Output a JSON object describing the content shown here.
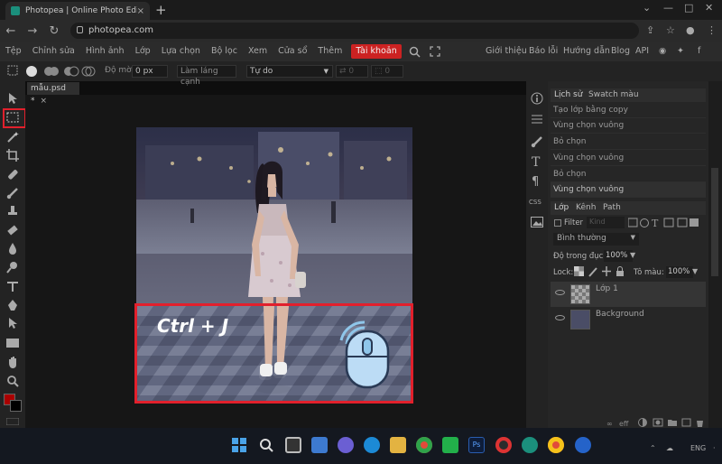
{
  "browser": {
    "tab_title": "Photopea | Online Photo Editor",
    "tab_close": "×",
    "new_tab": "+",
    "url": "photopea.com",
    "window_controls": [
      "⌄",
      "—",
      "□",
      "✕"
    ]
  },
  "menubar": {
    "items": [
      "Tệp",
      "Chỉnh sửa",
      "Hình ảnh",
      "Lớp",
      "Lựa chọn",
      "Bộ lọc",
      "Xem",
      "Cửa sổ",
      "Thêm"
    ],
    "account": "Tài khoản",
    "right_links": [
      "Giới thiệu",
      "Báo lỗi",
      "Hướng dẫn",
      "Blog",
      "API"
    ]
  },
  "options": {
    "feather_label": "Độ mờ:",
    "feather_value": "0 px",
    "refine_button": "Làm láng cạnh",
    "style_select": "Tự do",
    "width_value": "0",
    "height_value": "0"
  },
  "document": {
    "tab_name": "mẫu.psd *",
    "tab_close": "×",
    "overlay_text": "Ctrl + J"
  },
  "panels": {
    "history_tab": "Lịch sử",
    "swatch_tab": "Swatch màu",
    "history": [
      "Tạo lớp bằng copy",
      "Vùng chọn vuông",
      "Bỏ chọn",
      "Vùng chọn vuông",
      "Bỏ chọn",
      "Vùng chọn vuông"
    ],
    "layer_tabs": [
      "Lớp",
      "Kênh",
      "Path"
    ],
    "filter_label": "Filter",
    "filter_kind": "Kind",
    "blend_mode": "Bình thường",
    "opacity_label": "Độ trong đục:",
    "opacity_value": "100%",
    "lock_label": "Lock:",
    "fill_label": "Tô màu:",
    "fill_value": "100%",
    "layers": [
      "Lớp 1",
      "Background"
    ],
    "strip_labels": [
      "CSS"
    ]
  },
  "taskbar": {
    "lang": "ENG"
  },
  "colors": {
    "accent_red": "#e2202c",
    "brand_teal": "#1b8f7c",
    "mouse_blue": "#8fc6ea"
  }
}
